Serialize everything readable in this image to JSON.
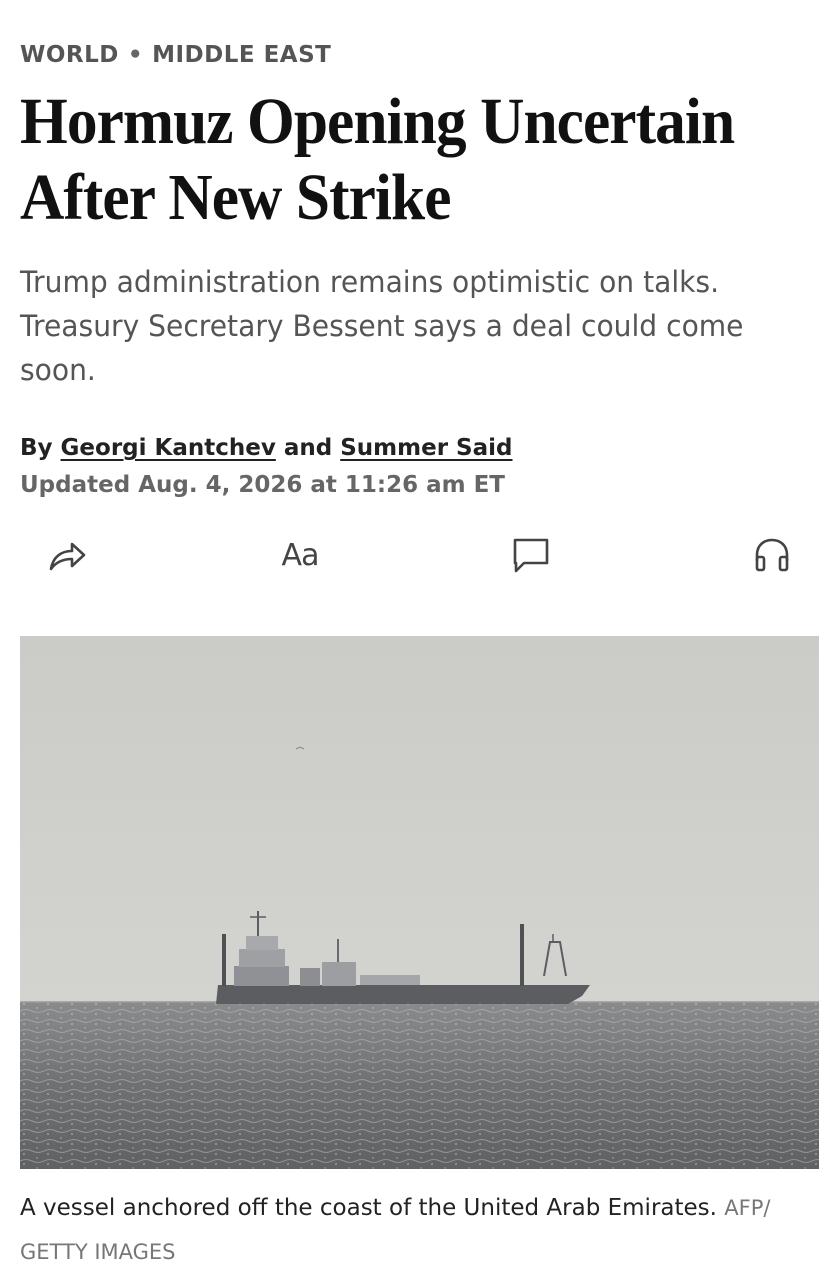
{
  "breadcrumb": {
    "section": "WORLD",
    "separator": "•",
    "subsection": "MIDDLE EAST"
  },
  "article": {
    "headline_line1": "Hormuz Opening Uncertain",
    "headline_line2": "After New Strike",
    "dek": "Trump administration remains optimistic on talks. Treasury Secretary Bessent says a deal could come soon.",
    "byline_prefix": "By",
    "author1": "Georgi Kantchev",
    "byline_joiner": "and",
    "author2": "Summer Said",
    "updated": "Updated Aug. 4, 2026 at 11:26 am ET"
  },
  "toolbar": {
    "share_icon": "share-icon",
    "font_label": "Aa",
    "comment_icon": "comment-icon",
    "listen_icon": "headphones-icon"
  },
  "photo": {
    "caption": "A vessel anchored off the coast of the United Arab Emirates.",
    "credit_line1": "AFP/",
    "credit_line2": "GETTY IMAGES"
  },
  "colors": {
    "text": "#111111",
    "muted": "#555555",
    "sky": "#cfcfcb",
    "sea": "#77787a"
  }
}
